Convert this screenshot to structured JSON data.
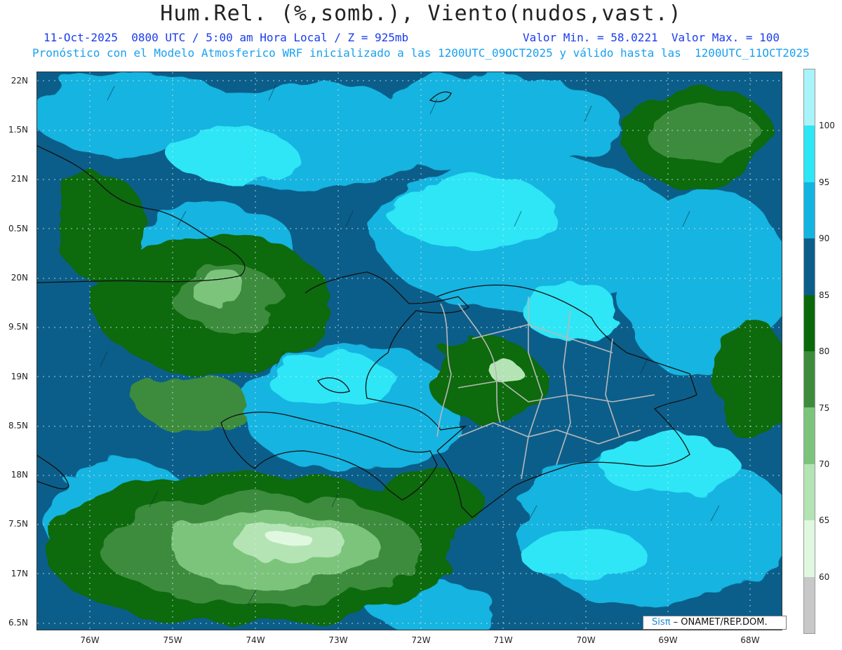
{
  "header": {
    "title": "Hum.Rel. (%,somb.), Viento(nudos,vast.)",
    "date_line": "11-Oct-2025  0800 UTC / 5:00 am Hora Local / Z = 925mb",
    "minmax_line": "Valor Min. = 58.0221  Valor Max. = 100",
    "model_line": "Pronóstico con el Modelo Atmosferico WRF inicializado a las 1200UTC_09OCT2025 y válido hasta las  1200UTC_11OCT2025"
  },
  "axes": {
    "lat_labels": [
      "22N",
      "1.5N",
      "21N",
      "0.5N",
      "20N",
      "9.5N",
      "19N",
      "8.5N",
      "18N",
      "7.5N",
      "17N",
      "6.5N"
    ],
    "lon_labels": [
      "76W",
      "75W",
      "74W",
      "73W",
      "72W",
      "71W",
      "70W",
      "69W",
      "68W"
    ]
  },
  "colorbar": {
    "labels": [
      "100",
      "95",
      "90",
      "85",
      "80",
      "75",
      "70",
      "65",
      "60"
    ],
    "colors": [
      "#c8c8c8",
      "#e0f8e0",
      "#b4e4b4",
      "#7cc47c",
      "#3c8c3c",
      "#0a6a0a",
      "#0b5e8a",
      "#14b4e0",
      "#2ee6f6",
      "#a8f4fa"
    ]
  },
  "credit": {
    "brand_prefix": "Sis",
    "brand_pi": "π",
    "text": " – ONAMET/REP.DOM."
  }
}
